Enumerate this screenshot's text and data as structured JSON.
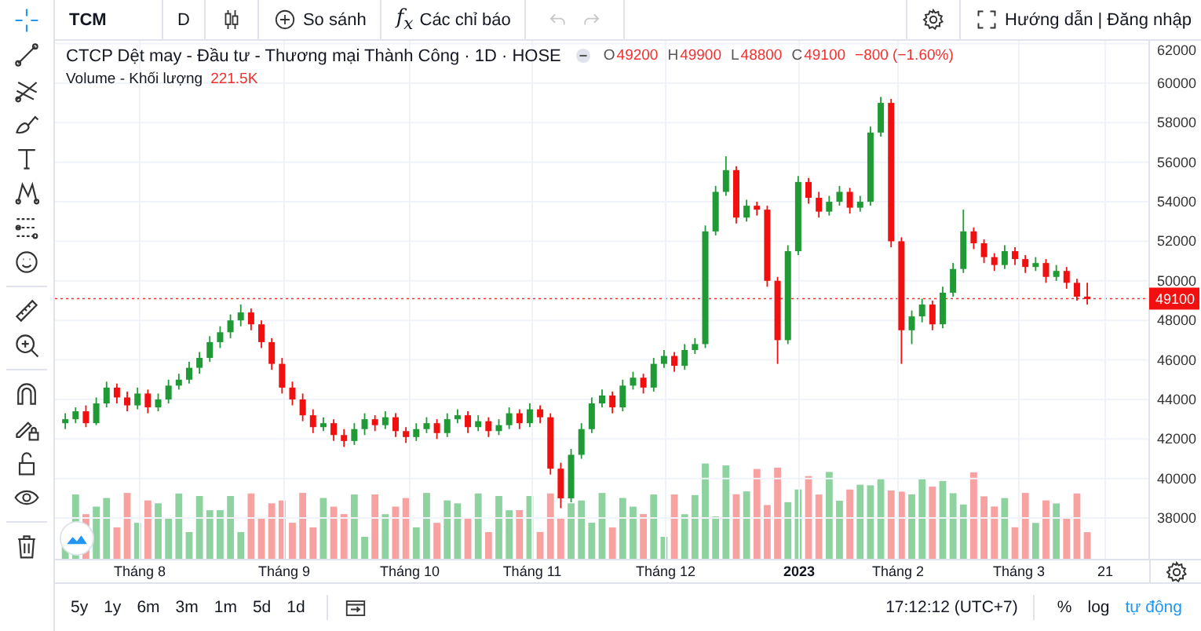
{
  "top_bar": {
    "symbol": "TCM",
    "interval": "D",
    "compare": "So sánh",
    "indicators": "f$_{x}$",
    "indicators_label": "Các chỉ báo",
    "undo": {
      "disabled": true
    },
    "redo": {
      "disabled": true
    },
    "help": "Hướng dẫn | Đăng nhập"
  },
  "legend": {
    "title": "CTCP Dệt may - Đầu tư - Thương mại Thành Công · 1D · HOSE",
    "ohlc": [
      {
        "label": "O",
        "value": "49200"
      },
      {
        "label": "H",
        "value": "49900"
      },
      {
        "label": "L",
        "value": "48800"
      },
      {
        "label": "C",
        "value": "49100"
      }
    ],
    "change": "−800 (−1.60%)",
    "volume_label": "Volume - Khối lượng",
    "volume_value": "221.5K"
  },
  "chart": {
    "last_price": "49100",
    "chart_data": {
      "type": "candlestick",
      "grid": true,
      "categories": [
        null,
        null,
        null,
        null,
        null,
        null,
        null,
        null,
        null,
        null,
        null,
        null,
        null,
        null,
        null,
        null,
        null,
        null,
        null,
        null,
        null,
        null,
        null,
        null,
        null,
        null,
        null,
        null,
        null,
        null,
        null,
        null,
        null,
        null,
        null,
        null,
        null,
        null,
        null,
        null,
        null,
        null,
        null,
        null,
        null,
        null,
        null,
        null,
        null,
        null,
        null,
        null,
        null,
        null,
        null,
        null,
        null,
        null,
        null,
        null,
        null,
        null,
        null,
        null,
        null,
        null,
        null,
        null,
        null,
        null,
        null,
        null,
        null,
        null,
        null,
        null,
        null,
        null,
        null,
        null,
        null,
        null,
        null,
        null,
        null,
        null,
        null,
        null,
        null,
        null,
        null,
        null,
        null,
        null,
        null,
        null,
        null,
        null,
        null,
        null
      ],
      "ohlc": [
        [
          42800,
          43300,
          42500,
          43000
        ],
        [
          43000,
          43600,
          42800,
          43400
        ],
        [
          43400,
          43700,
          42600,
          42800
        ],
        [
          42800,
          44100,
          42700,
          43800
        ],
        [
          43800,
          44900,
          43600,
          44600
        ],
        [
          44600,
          44800,
          43800,
          44100
        ],
        [
          44100,
          44400,
          43400,
          43700
        ],
        [
          43700,
          44600,
          43500,
          44300
        ],
        [
          44300,
          44500,
          43300,
          43600
        ],
        [
          43600,
          44300,
          43400,
          44000
        ],
        [
          44000,
          45000,
          43800,
          44700
        ],
        [
          44700,
          45300,
          44500,
          45000
        ],
        [
          45000,
          45900,
          44800,
          45600
        ],
        [
          45600,
          46400,
          45300,
          46100
        ],
        [
          46100,
          47200,
          45900,
          46900
        ],
        [
          46900,
          47700,
          46600,
          47400
        ],
        [
          47400,
          48300,
          47100,
          48000
        ],
        [
          48000,
          48800,
          47700,
          48400
        ],
        [
          48400,
          48600,
          47500,
          47800
        ],
        [
          47800,
          48000,
          46600,
          46900
        ],
        [
          46900,
          47100,
          45500,
          45800
        ],
        [
          45800,
          46100,
          44300,
          44600
        ],
        [
          44600,
          44900,
          43700,
          44000
        ],
        [
          44000,
          44300,
          42900,
          43200
        ],
        [
          43200,
          43500,
          42300,
          42600
        ],
        [
          42600,
          43100,
          42400,
          42800
        ],
        [
          42800,
          43000,
          41900,
          42200
        ],
        [
          42200,
          42500,
          41600,
          41900
        ],
        [
          41900,
          42800,
          41700,
          42500
        ],
        [
          42500,
          43300,
          42200,
          43000
        ],
        [
          43000,
          43200,
          42400,
          42700
        ],
        [
          42700,
          43400,
          42500,
          43100
        ],
        [
          43100,
          43300,
          42100,
          42400
        ],
        [
          42400,
          42600,
          41800,
          42100
        ],
        [
          42100,
          42800,
          41900,
          42500
        ],
        [
          42500,
          43100,
          42300,
          42800
        ],
        [
          42800,
          43000,
          42000,
          42300
        ],
        [
          42300,
          43300,
          42100,
          43000
        ],
        [
          43000,
          43500,
          42800,
          43200
        ],
        [
          43200,
          43400,
          42300,
          42600
        ],
        [
          42600,
          43200,
          42400,
          42900
        ],
        [
          42900,
          43100,
          42100,
          42400
        ],
        [
          42400,
          43000,
          42200,
          42700
        ],
        [
          42700,
          43600,
          42500,
          43300
        ],
        [
          43300,
          43500,
          42500,
          42800
        ],
        [
          42800,
          43800,
          42600,
          43500
        ],
        [
          43500,
          43700,
          42800,
          43100
        ],
        [
          43100,
          43300,
          40200,
          40500
        ],
        [
          40500,
          40800,
          38500,
          39000
        ],
        [
          39000,
          41500,
          38800,
          41200
        ],
        [
          41200,
          42800,
          41000,
          42500
        ],
        [
          42500,
          44100,
          42300,
          43800
        ],
        [
          43800,
          44500,
          43600,
          44200
        ],
        [
          44200,
          44400,
          43300,
          43600
        ],
        [
          43600,
          45000,
          43400,
          44700
        ],
        [
          44700,
          45400,
          44500,
          45100
        ],
        [
          45100,
          45300,
          44300,
          44600
        ],
        [
          44600,
          46100,
          44400,
          45800
        ],
        [
          45800,
          46500,
          45600,
          46200
        ],
        [
          46200,
          46400,
          45400,
          45700
        ],
        [
          45700,
          46800,
          45500,
          46500
        ],
        [
          46500,
          47100,
          46300,
          46800
        ],
        [
          46800,
          52800,
          46600,
          52500
        ],
        [
          52500,
          54800,
          52300,
          54500
        ],
        [
          54500,
          56300,
          54300,
          55600
        ],
        [
          55600,
          55800,
          52900,
          53200
        ],
        [
          53200,
          54100,
          53000,
          53800
        ],
        [
          53800,
          54000,
          53300,
          53600
        ],
        [
          53600,
          53800,
          49700,
          50000
        ],
        [
          50000,
          50200,
          45800,
          47000
        ],
        [
          47000,
          51800,
          46800,
          51500
        ],
        [
          51500,
          55300,
          51300,
          55000
        ],
        [
          55000,
          55200,
          53900,
          54200
        ],
        [
          54200,
          54500,
          53200,
          53500
        ],
        [
          53500,
          54300,
          53300,
          54000
        ],
        [
          54000,
          54800,
          53800,
          54500
        ],
        [
          54500,
          54700,
          53400,
          53700
        ],
        [
          53700,
          54300,
          53500,
          54000
        ],
        [
          54000,
          57800,
          53800,
          57500
        ],
        [
          57500,
          59300,
          57300,
          59000
        ],
        [
          59000,
          59200,
          51700,
          52000
        ],
        [
          52000,
          52200,
          45800,
          47500
        ],
        [
          47500,
          48500,
          46800,
          48200
        ],
        [
          48200,
          49100,
          47900,
          48800
        ],
        [
          48800,
          49000,
          47500,
          47800
        ],
        [
          47800,
          49700,
          47600,
          49400
        ],
        [
          49400,
          50900,
          49200,
          50600
        ],
        [
          50600,
          53600,
          50400,
          52500
        ],
        [
          52500,
          52700,
          51600,
          51900
        ],
        [
          51900,
          52100,
          50900,
          51200
        ],
        [
          51200,
          51400,
          50500,
          50800
        ],
        [
          50800,
          51800,
          50600,
          51500
        ],
        [
          51500,
          51700,
          50800,
          51100
        ],
        [
          51100,
          51300,
          50400,
          50700
        ],
        [
          50700,
          51200,
          50500,
          50900
        ],
        [
          50900,
          51100,
          49900,
          50200
        ],
        [
          50200,
          50800,
          50000,
          50500
        ],
        [
          50500,
          50700,
          49600,
          49900
        ],
        [
          49900,
          50100,
          49000,
          49200
        ],
        [
          49200,
          49900,
          48800,
          49100
        ]
      ],
      "ylim": [
        35940,
        62140
      ],
      "yticks": [
        {
          "value": 62000,
          "label": "62000"
        },
        {
          "value": 60000,
          "label": "60000"
        },
        {
          "value": 58000,
          "label": "58000"
        },
        {
          "value": 56000,
          "label": "56000"
        },
        {
          "value": 54000,
          "label": "54000"
        },
        {
          "value": 52000,
          "label": "52000"
        },
        {
          "value": 50000,
          "label": "50000"
        },
        {
          "value": 48000,
          "label": "48000"
        },
        {
          "value": 46000,
          "label": "46000"
        },
        {
          "value": 44000,
          "label": "44000"
        },
        {
          "value": 42000,
          "label": "42000"
        },
        {
          "value": 40000,
          "label": "40000"
        },
        {
          "value": 38000,
          "label": "38000"
        }
      ]
    }
  },
  "time_axis": {
    "labels": [
      {
        "label": "Tháng 8",
        "kind": "month"
      },
      {
        "label": "Tháng 9",
        "kind": "month"
      },
      {
        "label": "Tháng 10",
        "kind": "month"
      },
      {
        "label": "Tháng 11",
        "kind": "month"
      },
      {
        "label": "Tháng 12",
        "kind": "month"
      },
      {
        "label": "2023",
        "kind": "year"
      },
      {
        "label": "Tháng 2",
        "kind": "month"
      },
      {
        "label": "Tháng 3",
        "kind": "month"
      },
      {
        "label": "21",
        "kind": "day"
      }
    ]
  },
  "bottom_bar": {
    "ranges": [
      "5y",
      "1y",
      "6m",
      "3m",
      "1m",
      "5d",
      "1d"
    ],
    "time": "17:12:12 (UTC+7)",
    "options": [
      {
        "label": "%",
        "selected": false
      },
      {
        "label": "log",
        "selected": false
      },
      {
        "label": "tự động",
        "selected": true
      }
    ]
  }
}
